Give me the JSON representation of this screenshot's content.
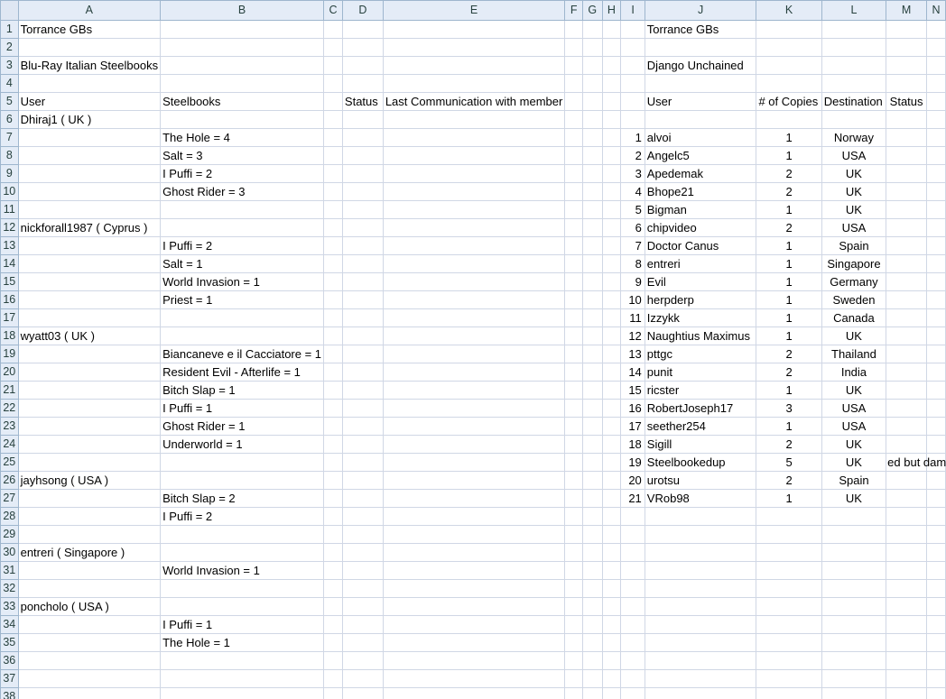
{
  "columns": [
    "A",
    "B",
    "C",
    "D",
    "E",
    "F",
    "G",
    "H",
    "I",
    "J",
    "K",
    "L",
    "M",
    "N"
  ],
  "left": {
    "title": "Torrance GBs",
    "subtitle": "Blu-Ray Italian Steelbooks",
    "headers": {
      "user": "User",
      "steelbooks": "Steelbooks",
      "status": "Status",
      "last_comm": "Last Communication with member"
    },
    "groups": [
      {
        "member": "Dhiraj1 ( UK )",
        "items": [
          "The Hole = 4",
          "Salt = 3",
          "I Puffi = 2",
          "Ghost Rider = 3"
        ]
      },
      {
        "member": "nickforall1987 ( Cyprus )",
        "items": [
          "I Puffi = 2",
          "Salt = 1",
          "World Invasion = 1",
          "Priest = 1"
        ]
      },
      {
        "member": "wyatt03 ( UK )",
        "items": [
          "Biancaneve e il Cacciatore = 1",
          "Resident Evil - Afterlife = 1",
          "Bitch Slap = 1",
          "I Puffi = 1",
          "Ghost Rider = 1",
          "Underworld = 1"
        ]
      },
      {
        "member": "jayhsong ( USA )",
        "items": [
          "Bitch Slap = 2",
          "I Puffi = 2"
        ]
      },
      {
        "member": "entreri ( Singapore )",
        "items": [
          "World Invasion = 1"
        ]
      },
      {
        "member": "poncholo ( USA )",
        "items": [
          "I Puffi = 1",
          "The Hole = 1"
        ]
      }
    ]
  },
  "right": {
    "title": "Torrance GBs",
    "subtitle": "Django Unchained",
    "headers": {
      "user": "User",
      "copies": "# of Copies",
      "destination": "Destination",
      "status": "Status"
    },
    "rows": [
      {
        "n": 1,
        "user": "alvoi",
        "copies": 1,
        "destination": "Norway",
        "status": ""
      },
      {
        "n": 2,
        "user": "Angelc5",
        "copies": 1,
        "destination": "USA",
        "status": ""
      },
      {
        "n": 3,
        "user": "Apedemak",
        "copies": 2,
        "destination": "UK",
        "status": ""
      },
      {
        "n": 4,
        "user": "Bhope21",
        "copies": 2,
        "destination": "UK",
        "status": ""
      },
      {
        "n": 5,
        "user": "Bigman",
        "copies": 1,
        "destination": "UK",
        "status": ""
      },
      {
        "n": 6,
        "user": "chipvideo",
        "copies": 2,
        "destination": "USA",
        "status": ""
      },
      {
        "n": 7,
        "user": "Doctor Canus",
        "copies": 1,
        "destination": "Spain",
        "status": ""
      },
      {
        "n": 8,
        "user": "entreri",
        "copies": 1,
        "destination": "Singapore",
        "status": ""
      },
      {
        "n": 9,
        "user": "Evil",
        "copies": 1,
        "destination": "Germany",
        "status": ""
      },
      {
        "n": 10,
        "user": "herpderp",
        "copies": 1,
        "destination": "Sweden",
        "status": ""
      },
      {
        "n": 11,
        "user": "Izzykk",
        "copies": 1,
        "destination": "Canada",
        "status": ""
      },
      {
        "n": 12,
        "user": "Naughtius Maximus",
        "copies": 1,
        "destination": "UK",
        "status": ""
      },
      {
        "n": 13,
        "user": "pttgc",
        "copies": 2,
        "destination": "Thailand",
        "status": ""
      },
      {
        "n": 14,
        "user": "punit",
        "copies": 2,
        "destination": "India",
        "status": ""
      },
      {
        "n": 15,
        "user": "ricster",
        "copies": 1,
        "destination": "UK",
        "status": ""
      },
      {
        "n": 16,
        "user": "RobertJoseph17",
        "copies": 3,
        "destination": "USA",
        "status": ""
      },
      {
        "n": 17,
        "user": "seether254",
        "copies": 1,
        "destination": "USA",
        "status": ""
      },
      {
        "n": 18,
        "user": "Sigill",
        "copies": 2,
        "destination": "UK",
        "status": ""
      },
      {
        "n": 19,
        "user": "Steelbookedup",
        "copies": 5,
        "destination": "UK",
        "status": "ed but damaged"
      },
      {
        "n": 20,
        "user": "urotsu",
        "copies": 2,
        "destination": "Spain",
        "status": ""
      },
      {
        "n": 21,
        "user": "VRob98",
        "copies": 1,
        "destination": "UK",
        "status": ""
      }
    ]
  }
}
